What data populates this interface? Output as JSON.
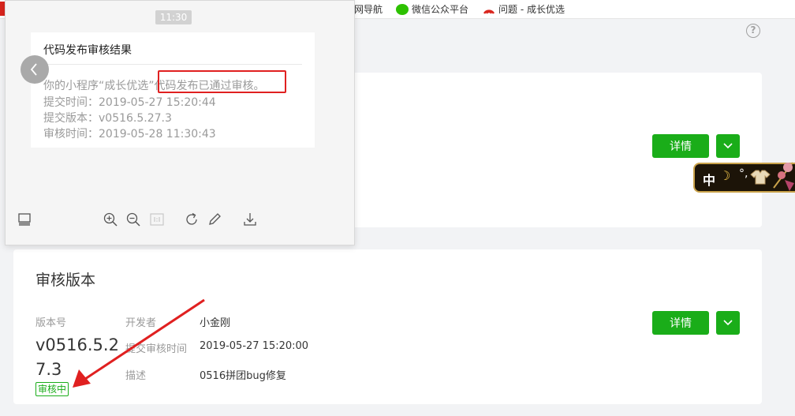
{
  "bookmarks": {
    "items": [
      {
        "label": "网导航"
      },
      {
        "label": "微信公众平台",
        "icon": "wechat-icon"
      },
      {
        "label": "问题 - 成长优选",
        "icon": "arc-icon"
      }
    ]
  },
  "card1": {
    "detail_label": "详情"
  },
  "card2": {
    "title": "审核版本",
    "version_label": "版本号",
    "version_value": "v0516.5.27.3",
    "status_badge": "审核中",
    "developer_label": "开发者",
    "developer_value": "小金刚",
    "submit_time_label": "提交审核时间",
    "submit_time_value": "2019-05-27 15:20:00",
    "desc_label": "描述",
    "desc_value": "0516拼团bug修复",
    "detail_label": "详情"
  },
  "ime": {
    "mode": "中",
    "punct": "°,"
  },
  "viewer": {
    "time": "11:30",
    "message": {
      "title": "代码发布审核结果",
      "body_line1": "你的小程序“成长优选”代码发布已通过审核。",
      "body_line2": "提交时间：2019-05-27 15:20:44",
      "body_line3": "提交版本：v0516.5.27.3",
      "body_line4": "审核时间：2019-05-28 11:30:43"
    },
    "toolbar": [
      "thumbnail-icon",
      "zoom-in-icon",
      "zoom-out-icon",
      "actual-size-icon",
      "rotate-icon",
      "edit-icon",
      "download-icon"
    ]
  },
  "colors": {
    "accent_green": "#1aad19",
    "annotation_red": "#e02020"
  }
}
